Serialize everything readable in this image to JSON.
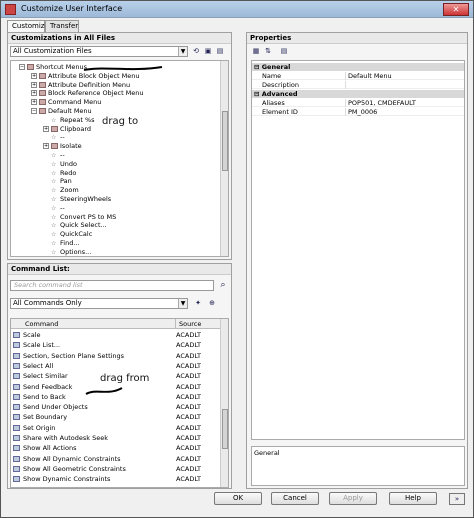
{
  "window": {
    "title": "Customize User Interface",
    "close_glyph": "✕"
  },
  "tabs": [
    "Customize",
    "Transfer"
  ],
  "left_top": {
    "title": "Customizations in All Files",
    "filter": "All Customization Files",
    "annotation": "drag to",
    "tree": [
      {
        "label": "Shortcut Menus",
        "indent": 0,
        "exp": "−",
        "icon": "folder"
      },
      {
        "label": "Attribute Block Object Menu",
        "indent": 1,
        "exp": "+",
        "icon": "folder"
      },
      {
        "label": "Attribute Definition Menu",
        "indent": 1,
        "exp": "+",
        "icon": "folder"
      },
      {
        "label": "Block Reference Object Menu",
        "indent": 1,
        "exp": "+",
        "icon": "folder"
      },
      {
        "label": "Command Menu",
        "indent": 1,
        "exp": "+",
        "icon": "folder"
      },
      {
        "label": "Default Menu",
        "indent": 1,
        "exp": "−",
        "icon": "folder"
      },
      {
        "label": "Repeat %s",
        "indent": 2,
        "exp": "",
        "icon": "star"
      },
      {
        "label": "Clipboard",
        "indent": 2,
        "exp": "+",
        "icon": "folder"
      },
      {
        "label": "--",
        "indent": 2,
        "exp": "",
        "icon": "star"
      },
      {
        "label": "Isolate",
        "indent": 2,
        "exp": "+",
        "icon": "folder"
      },
      {
        "label": "--",
        "indent": 2,
        "exp": "",
        "icon": "star"
      },
      {
        "label": "Undo",
        "indent": 2,
        "exp": "",
        "icon": "star"
      },
      {
        "label": "Redo",
        "indent": 2,
        "exp": "",
        "icon": "star"
      },
      {
        "label": "Pan",
        "indent": 2,
        "exp": "",
        "icon": "star"
      },
      {
        "label": "Zoom",
        "indent": 2,
        "exp": "",
        "icon": "star"
      },
      {
        "label": "SteeringWheels",
        "indent": 2,
        "exp": "",
        "icon": "star"
      },
      {
        "label": "--",
        "indent": 2,
        "exp": "",
        "icon": "star"
      },
      {
        "label": "Convert PS to MS",
        "indent": 2,
        "exp": "",
        "icon": "star"
      },
      {
        "label": "Quick Select...",
        "indent": 2,
        "exp": "",
        "icon": "star"
      },
      {
        "label": "QuickCalc",
        "indent": 2,
        "exp": "",
        "icon": "star"
      },
      {
        "label": "Find...",
        "indent": 2,
        "exp": "",
        "icon": "star"
      },
      {
        "label": "Options...",
        "indent": 2,
        "exp": "",
        "icon": "star"
      }
    ]
  },
  "command_list": {
    "title": "Command List:",
    "search_placeholder": "Search command list",
    "filter": "All Commands Only",
    "col_command": "Command",
    "col_source": "Source",
    "annotation": "drag from",
    "rows": [
      {
        "command": "Scale",
        "source": "ACADLT"
      },
      {
        "command": "Scale List...",
        "source": "ACADLT"
      },
      {
        "command": "Section, Section Plane Settings",
        "source": "ACADLT"
      },
      {
        "command": "Select All",
        "source": "ACADLT"
      },
      {
        "command": "Select Similar",
        "source": "ACADLT"
      },
      {
        "command": "Send Feedback",
        "source": "ACADLT"
      },
      {
        "command": "Send to Back",
        "source": "ACADLT"
      },
      {
        "command": "Send Under Objects",
        "source": "ACADLT"
      },
      {
        "command": "Set Boundary",
        "source": "ACADLT"
      },
      {
        "command": "Set Origin",
        "source": "ACADLT"
      },
      {
        "command": "Share with Autodesk Seek",
        "source": "ACADLT"
      },
      {
        "command": "Show All Actions",
        "source": "ACADLT"
      },
      {
        "command": "Show All Dynamic Constraints",
        "source": "ACADLT"
      },
      {
        "command": "Show All Geometric Constraints",
        "source": "ACADLT"
      },
      {
        "command": "Show Dynamic Constraints",
        "source": "ACADLT"
      }
    ]
  },
  "properties": {
    "title": "Properties",
    "categories": [
      {
        "name": "General",
        "rows": [
          {
            "key": "Name",
            "value": "Default Menu"
          },
          {
            "key": "Description",
            "value": ""
          }
        ]
      },
      {
        "name": "Advanced",
        "rows": [
          {
            "key": "Aliases",
            "value": "POP501, CMDEFAULT"
          },
          {
            "key": "Element ID",
            "value": "PM_0006"
          }
        ]
      }
    ],
    "description_title": "General"
  },
  "buttons": {
    "ok": "OK",
    "cancel": "Cancel",
    "apply": "Apply",
    "help": "Help"
  }
}
